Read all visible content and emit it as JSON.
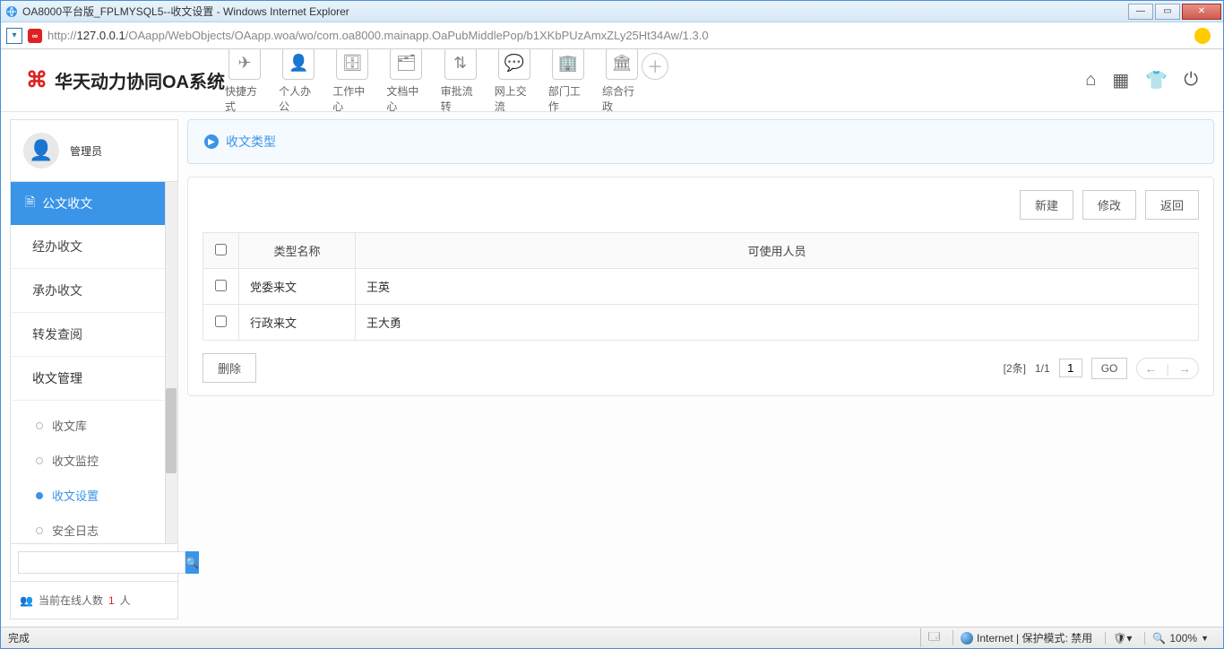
{
  "window": {
    "title": "OA8000平台版_FPLMYSQL5--收文设置 - Windows Internet Explorer",
    "url_prefix": "http://",
    "url_host": "127.0.0.1",
    "url_path": "/OAapp/WebObjects/OAapp.woa/wo/com.oa8000.mainapp.OaPubMiddlePop/b1XKbPUzAmxZLy25Ht34Aw/1.3.0"
  },
  "logo": {
    "text": "华天动力协同OA系统"
  },
  "topnav": [
    {
      "label": "快捷方式",
      "icon": "✈"
    },
    {
      "label": "个人办公",
      "icon": "👤"
    },
    {
      "label": "工作中心",
      "icon": "🗄"
    },
    {
      "label": "文档中心",
      "icon": "🗂"
    },
    {
      "label": "审批流转",
      "icon": "⇅"
    },
    {
      "label": "网上交流",
      "icon": "💬"
    },
    {
      "label": "部门工作",
      "icon": "🏢"
    },
    {
      "label": "综合行政",
      "icon": "🏛"
    }
  ],
  "sidebar": {
    "user": "管理员",
    "section": "公文收文",
    "groups": [
      "经办收文",
      "承办收文",
      "转发查阅",
      "收文管理"
    ],
    "subitems": [
      "收文库",
      "收文监控",
      "收文设置",
      "安全日志"
    ],
    "active_sub": "收文设置",
    "search_placeholder": "",
    "online_label": "当前在线人数",
    "online_count": "1",
    "online_unit": "人"
  },
  "panel": {
    "title": "收文类型"
  },
  "buttons": {
    "create": "新建",
    "edit": "修改",
    "back": "返回",
    "delete": "删除",
    "go": "GO"
  },
  "table": {
    "headers": {
      "name": "类型名称",
      "users": "可使用人员"
    },
    "rows": [
      {
        "name": "党委来文",
        "users": "王英"
      },
      {
        "name": "行政来文",
        "users": "王大勇"
      }
    ]
  },
  "pager": {
    "total": "[2条]",
    "pages": "1/1",
    "input": "1"
  },
  "statusbar": {
    "left": "完成",
    "zone": "Internet | 保护模式: 禁用",
    "zoom": "100%"
  }
}
